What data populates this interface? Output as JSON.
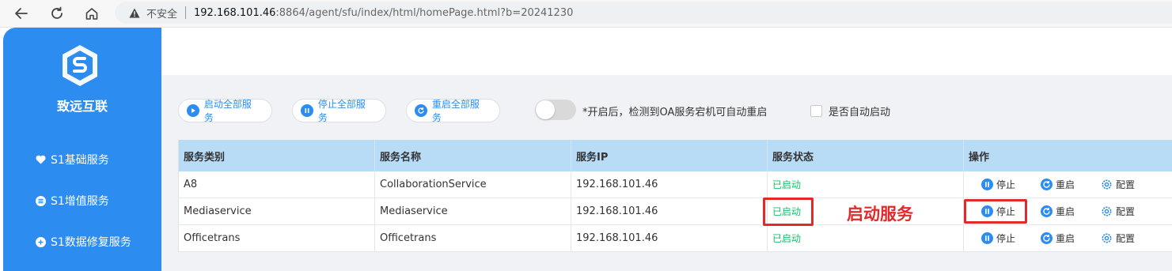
{
  "browser": {
    "insecure_label": "不安全",
    "url_host": "192.168.101.46",
    "url_path": ":8864/agent/sfu/index/html/homePage.html?b=20241230"
  },
  "sidebar": {
    "brand": "致远互联",
    "items": [
      {
        "label": "S1基础服务",
        "icon": "heart-icon"
      },
      {
        "label": "S1增值服务",
        "icon": "list-icon"
      },
      {
        "label": "S1数据修复服务",
        "icon": "plus-icon"
      }
    ]
  },
  "toolbar": {
    "start_all": "启动全部服务",
    "stop_all": "停止全部服务",
    "restart_all": "重启全部服务",
    "toggle_text": "*开启后，检测到OA服务宕机可自动重启",
    "auto_start_label": "是否自动启动"
  },
  "table": {
    "headers": [
      "服务类别",
      "服务名称",
      "服务IP",
      "服务状态",
      "操作"
    ],
    "rows": [
      {
        "category": "A8",
        "name": "CollaborationService",
        "ip": "192.168.101.46",
        "status": "已启动"
      },
      {
        "category": "Mediaservice",
        "name": "Mediaservice",
        "ip": "192.168.101.46",
        "status": "已启动"
      },
      {
        "category": "Officetrans",
        "name": "Officetrans",
        "ip": "192.168.101.46",
        "status": "已启动"
      }
    ],
    "actions": {
      "stop": "停止",
      "restart": "重启",
      "config": "配置"
    }
  },
  "annotation": {
    "text": "启动服务"
  },
  "colors": {
    "sidebar": "#2d8cf0",
    "accent": "#2d8cf0",
    "status_ok": "#19be6b",
    "annotation": "#e12b2b",
    "table_header": "#b9dcf6"
  }
}
